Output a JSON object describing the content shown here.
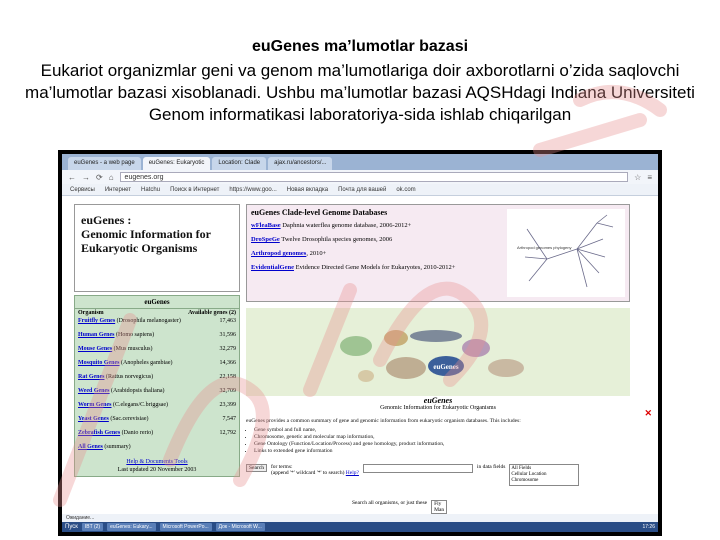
{
  "slide": {
    "heading": "euGenes ma’lumotlar bazasi",
    "body": "Eukariot organizmlar geni va genom ma’lumotlariga doir axborotlarni o’zida saqlovchi ma’lumotlar bazasi  xisoblanadi. Ushbu ma’lumotlar bazasi AQSHdagi Indiana Universiteti Genom informatikasi laboratoriya-sida ishlab chiqarilgan"
  },
  "browser": {
    "tabs": [
      "euGenes - a web page",
      "euGenes: Eukaryotic",
      "Location: Clade",
      "ajax.ru/ancestors/..."
    ],
    "url": "eugenes.org",
    "bookmarks": [
      "Сервисы",
      "Интернет",
      "Hatchu",
      "Поиск в Интернет",
      "https://www.goo...",
      "Новая вкладка",
      "Почта для вашей",
      "ok.com"
    ]
  },
  "site": {
    "logo_line1": "euGenes :",
    "logo_line2": "Genomic Information for",
    "logo_line3": "Eukaryotic Organisms",
    "table_title": "euGenes",
    "col_organism": "Organism",
    "col_genes": "Available genes (2)",
    "genes": [
      {
        "name": "Fruitfly Genes",
        "latin": "(Drosophila melanogaster)",
        "count": "17,463"
      },
      {
        "name": "Human Genes",
        "latin": "(Homo sapiens)",
        "count": "31,596"
      },
      {
        "name": "Mouse Genes",
        "latin": "(Mus musculus)",
        "count": "32,279"
      },
      {
        "name": "Mosquito Genes",
        "latin": "(Anopheles gambiae)",
        "count": "14,366"
      },
      {
        "name": "Rat Genes",
        "latin": "(Rattus norvegicus)",
        "count": "22,158"
      },
      {
        "name": "Weed Genes",
        "latin": "(Arabidopsis thaliana)",
        "count": "32,709"
      },
      {
        "name": "Worm Genes",
        "latin": "(C.elegans/C.briggsae)",
        "count": "23,399"
      },
      {
        "name": "Yeast Genes",
        "latin": "(Sac.cerevisiae)",
        "count": "7,547"
      },
      {
        "name": "Zebrafish Genes",
        "latin": "(Danio rerio)",
        "count": "12,792"
      },
      {
        "name": "All Genes",
        "latin": "(summary)",
        "count": ""
      }
    ],
    "help_link": "Help & Documents   Tools",
    "updated": "Last updated 20 November 2003",
    "clade_title": "euGenes Clade-level Genome Databases",
    "clade_dbs": [
      {
        "name": "wFleaBase",
        "desc": "Daphnia waterflea genome database, 2006-2012+"
      },
      {
        "name": "DroSpeGe",
        "desc": "Twelve Drosophila species genomes, 2006"
      },
      {
        "name": "Arthropod genomes",
        "desc": ", 2010+"
      },
      {
        "name": "EvidentialGene",
        "desc": "Evidence Directed Gene Models for Eukaryotes, 2010-2012+"
      }
    ],
    "tree_label": "Arthropod genomes phylogeny",
    "main_title": "euGenes",
    "main_subtitle": "Genomic Information for Eukaryotic Organisms",
    "image_logo": "euGenes",
    "description": "euGenes provides a common summary of gene and genomic information from eukaryotic organism databases. This includes:",
    "bullets": [
      "Gene symbol and full name,",
      "Chromosome, genetic and molecular map information,",
      "Gene Ontology (Function/Location/Process) and gene homology, product information,",
      "Links to extended gene information"
    ],
    "search_button": "Search",
    "search_for": "for terms:",
    "search_hint": "(append '*' wildcard '*' to search)",
    "search_help": "Help?",
    "in_fields": "in data fields",
    "field_options": [
      "All Fields",
      "Cellular Location",
      "Chromosome"
    ],
    "search_all": "Search all organisms, or just these",
    "organism_opt1": "Fly",
    "organism_opt2": "Man"
  },
  "statusbar": "Ожидание...",
  "taskbar": {
    "start": "Пуск",
    "tasks": [
      "IBT (2)",
      "euGenes: Eukary...",
      "Microsoft PowerPo...",
      "Док - Microsoft W..."
    ],
    "clock": "17:26"
  },
  "colors": {
    "watermark": "#e89090",
    "table_bg": "#cde4cd",
    "clade_bg": "#f6eaf2",
    "link": "#0000cc"
  }
}
